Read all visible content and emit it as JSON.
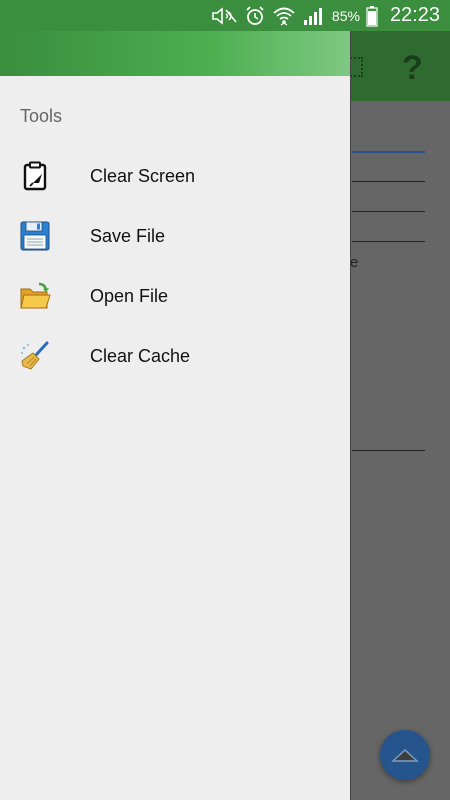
{
  "status_bar": {
    "battery": "85%",
    "time": "22:23",
    "icons": [
      "mute-icon",
      "alarm-icon",
      "wifi-icon",
      "signal-icon",
      "battery-icon"
    ]
  },
  "drawer": {
    "section_label": "Tools",
    "items": [
      {
        "label": "Clear Screen",
        "icon": "clipboard-icon"
      },
      {
        "label": "Save File",
        "icon": "floppy-disk-icon"
      },
      {
        "label": "Open File",
        "icon": "open-folder-icon"
      },
      {
        "label": "Clear Cache",
        "icon": "broom-icon"
      }
    ]
  },
  "background": {
    "toolbar_help": "?",
    "text_fragment": "e"
  },
  "colors": {
    "status_bar": "#3a8e3d",
    "drawer_bg": "#eeeeee",
    "fab": "#26548c"
  }
}
